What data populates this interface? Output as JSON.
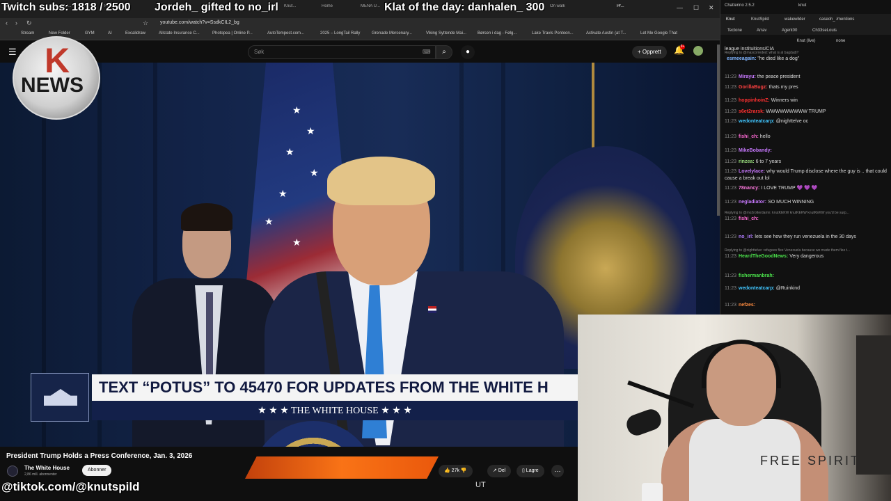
{
  "browser": {
    "tabs": [
      "Stream",
      "Xtr...",
      "Frou...",
      "Trainin...",
      "Knut...",
      "Home",
      "MENA U...",
      "Klat...",
      "On walk",
      "Pr..."
    ],
    "url": "youtube.com/watch?v=SsdkCIL2_bg",
    "bookmarks": [
      "Stream",
      "New Folder",
      "GYM",
      "AI",
      "Excalidraw",
      "Allstate Insurance C...",
      "Photopea | Online P...",
      "AutoTempest.com...",
      "2025 – LongTail Rally",
      "Grenade Mercenary...",
      "Viking Syttende Mai...",
      "Børsen i dag - Følg...",
      "Lake Travis Pontoon...",
      "Activate Austin (at T...",
      "Let Me Google That"
    ]
  },
  "youtube": {
    "search_placeholder": "Søk",
    "create_label": "Opprett",
    "notification_count": "9+",
    "video_title": "President Trump Holds a Press Conference, Jan. 3, 2026",
    "channel_name": "The White House",
    "channel_subs": "2,86 mill. abonnenter",
    "subscribe_label": "Abonner",
    "likes": "27k",
    "share_label": "Del",
    "save_label": "Lagre"
  },
  "video": {
    "lower_third_main": "TEXT “POTUS” TO 45470 FOR UPDATES FROM THE WHITE H",
    "lower_third_sub": "★ ★ ★  THE WHITE HOUSE  ★ ★ ★"
  },
  "overlays": {
    "logo_letter": "K",
    "logo_word": "NEWS",
    "twitch_subs": "Twitch subs: 1818 / 2500",
    "gifted": "Jordeh_ gifted to no_irl",
    "klat": "Klat of the day: danhalen_ 300",
    "tiktok": "@tiktok.com/@knutspild",
    "ut": "UT",
    "webcam_brand": "FREE SPIRIT"
  },
  "chatterino": {
    "title": "Chatterino 2.5.2",
    "user": "knut",
    "tabs_row1": [
      "Knut",
      "KnutSpild",
      "wakewilder",
      "caseoh_ /mentions"
    ],
    "tabs_row2": [
      "Tectone",
      "Arrav",
      "Agent00",
      "Ch33seLouis"
    ],
    "channel": "Knut (live)",
    "mode": "none",
    "top_line": "league instituitions/CIA",
    "messages": [
      {
        "time": "",
        "user": "esmeeagain:",
        "color": "#7fb4ff",
        "text": "\"he died like a dog\"",
        "reply": "Replying to @maxcorreded: what is al bagdadi?"
      },
      {
        "time": "11:23",
        "user": "Mirayu:",
        "color": "#c879ff",
        "text": "the peace president",
        "reply": ""
      },
      {
        "time": "11:23",
        "user": "GorillaBugz:",
        "color": "#ff4040",
        "text": "thats my pres",
        "reply": ""
      },
      {
        "time": "11:23",
        "user": "hoppinhoinZ:",
        "color": "#ff3030",
        "text": "Winners win",
        "reply": ""
      },
      {
        "time": "11:23",
        "user": "s6et2rarsk:",
        "color": "#ff3030",
        "text": "WWWWWWWWW TRUMP",
        "reply": ""
      },
      {
        "time": "11:23",
        "user": "wedonteatcarp:",
        "color": "#41c6ff",
        "text": "@nighttelve oc",
        "reply": ""
      },
      {
        "time": "11:23",
        "user": "fishi_ch:",
        "color": "#ff6ad5",
        "text": "hello",
        "reply": ""
      },
      {
        "time": "11:23",
        "user": "MikeBobandy:",
        "color": "#c879ff",
        "text": "",
        "reply": ""
      },
      {
        "time": "11:23",
        "user": "rinzea:",
        "color": "#9adf7e",
        "text": "6 to 7 years",
        "reply": ""
      },
      {
        "time": "11:23",
        "user": "Lovelylace:",
        "color": "#c879ff",
        "text": "why would Trump disclose where the guy is .. that could cause a break out lol",
        "reply": ""
      },
      {
        "time": "11:23",
        "user": "78nancy:",
        "color": "#ff7ae0",
        "text": "I LOVE TRUMP 💜 💜 💜",
        "reply": ""
      },
      {
        "time": "11:23",
        "user": "negladiator:",
        "color": "#c879ff",
        "text": "SO MUCH WINNING",
        "reply": ""
      },
      {
        "time": "11:23",
        "user": "fishi_ch:",
        "color": "#ff6ad5",
        "text": "",
        "reply": "Replying to @mo2rotterdamn: knutKEKW knutKEKW knutKEKW you'd be surp..."
      },
      {
        "time": "11:23",
        "user": "no_irl:",
        "color": "#b07cff",
        "text": "lets see how they run venezuela in the 30 days",
        "reply": ""
      },
      {
        "time": "11:23",
        "user": "HeardTheGoodNews:",
        "color": "#4be24b",
        "text": "Very dangerous",
        "reply": "Replying to @nighttelve: refugees flee Venezuela because we made them flee t..."
      },
      {
        "time": "11:23",
        "user": "fishermanbrah:",
        "color": "#4be24b",
        "text": "",
        "reply": ""
      },
      {
        "time": "11:23",
        "user": "wedonteatcarp:",
        "color": "#41c6ff",
        "text": "@Ruinkind",
        "reply": ""
      },
      {
        "time": "11:23",
        "user": "nefzes:",
        "color": "#ff8c40",
        "text": "",
        "reply": ""
      }
    ]
  }
}
